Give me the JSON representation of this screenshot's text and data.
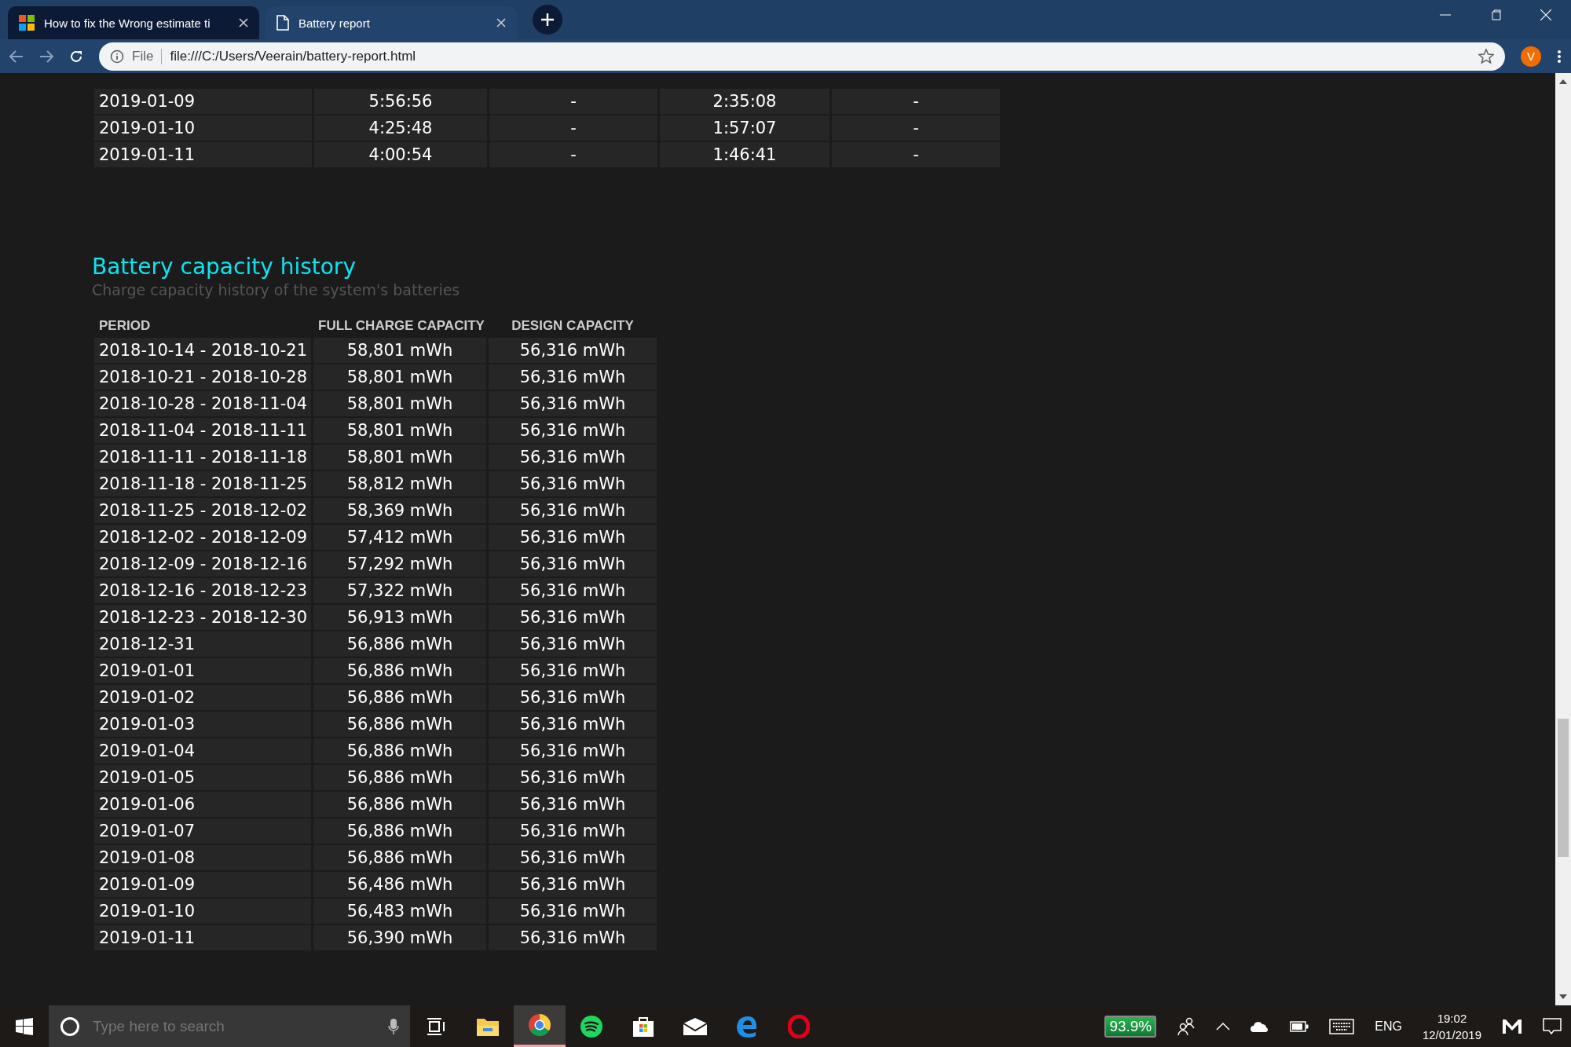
{
  "browser": {
    "tabs": [
      {
        "title": "How to fix the Wrong estimate ti",
        "kind": "windows",
        "selected": false
      },
      {
        "title": "Battery report",
        "kind": "page",
        "selected": true
      }
    ],
    "address": {
      "scheme": "File",
      "url": "file:///C:/Users/Veerain/battery-report.html"
    },
    "profile": "V"
  },
  "usage_table": {
    "rows": [
      [
        "2019-01-09",
        "5:56:56",
        "-",
        "2:35:08",
        "-"
      ],
      [
        "2019-01-10",
        "4:25:48",
        "-",
        "1:57:07",
        "-"
      ],
      [
        "2019-01-11",
        "4:00:54",
        "-",
        "1:46:41",
        "-"
      ]
    ]
  },
  "capacity_section": {
    "title": "Battery capacity history",
    "subtitle": "Charge capacity history of the system's batteries",
    "columns": [
      "PERIOD",
      "FULL CHARGE CAPACITY",
      "DESIGN CAPACITY"
    ],
    "rows": [
      [
        "2018-10-14 - 2018-10-21",
        "58,801 mWh",
        "56,316 mWh"
      ],
      [
        "2018-10-21 - 2018-10-28",
        "58,801 mWh",
        "56,316 mWh"
      ],
      [
        "2018-10-28 - 2018-11-04",
        "58,801 mWh",
        "56,316 mWh"
      ],
      [
        "2018-11-04 - 2018-11-11",
        "58,801 mWh",
        "56,316 mWh"
      ],
      [
        "2018-11-11 - 2018-11-18",
        "58,801 mWh",
        "56,316 mWh"
      ],
      [
        "2018-11-18 - 2018-11-25",
        "58,812 mWh",
        "56,316 mWh"
      ],
      [
        "2018-11-25 - 2018-12-02",
        "58,369 mWh",
        "56,316 mWh"
      ],
      [
        "2018-12-02 - 2018-12-09",
        "57,412 mWh",
        "56,316 mWh"
      ],
      [
        "2018-12-09 - 2018-12-16",
        "57,292 mWh",
        "56,316 mWh"
      ],
      [
        "2018-12-16 - 2018-12-23",
        "57,322 mWh",
        "56,316 mWh"
      ],
      [
        "2018-12-23 - 2018-12-30",
        "56,913 mWh",
        "56,316 mWh"
      ],
      [
        "2018-12-31",
        "56,886 mWh",
        "56,316 mWh"
      ],
      [
        "2019-01-01",
        "56,886 mWh",
        "56,316 mWh"
      ],
      [
        "2019-01-02",
        "56,886 mWh",
        "56,316 mWh"
      ],
      [
        "2019-01-03",
        "56,886 mWh",
        "56,316 mWh"
      ],
      [
        "2019-01-04",
        "56,886 mWh",
        "56,316 mWh"
      ],
      [
        "2019-01-05",
        "56,886 mWh",
        "56,316 mWh"
      ],
      [
        "2019-01-06",
        "56,886 mWh",
        "56,316 mWh"
      ],
      [
        "2019-01-07",
        "56,886 mWh",
        "56,316 mWh"
      ],
      [
        "2019-01-08",
        "56,886 mWh",
        "56,316 mWh"
      ],
      [
        "2019-01-09",
        "56,486 mWh",
        "56,316 mWh"
      ],
      [
        "2019-01-10",
        "56,483 mWh",
        "56,316 mWh"
      ],
      [
        "2019-01-11",
        "56,390 mWh",
        "56,316 mWh"
      ]
    ]
  },
  "taskbar": {
    "search": {
      "placeholder": "Type here to search"
    },
    "apps": [
      {
        "kind": "taskview",
        "selected": false
      },
      {
        "kind": "files",
        "selected": false
      },
      {
        "kind": "chrome",
        "selected": true
      },
      {
        "kind": "spotify",
        "selected": false
      },
      {
        "kind": "store",
        "selected": false
      },
      {
        "kind": "mail",
        "selected": false
      },
      {
        "kind": "edge",
        "selected": false
      },
      {
        "kind": "opera",
        "selected": false
      }
    ],
    "battery_badge": "93.9%",
    "language": "ENG",
    "time": "19:02",
    "date": "12/01/2019"
  }
}
